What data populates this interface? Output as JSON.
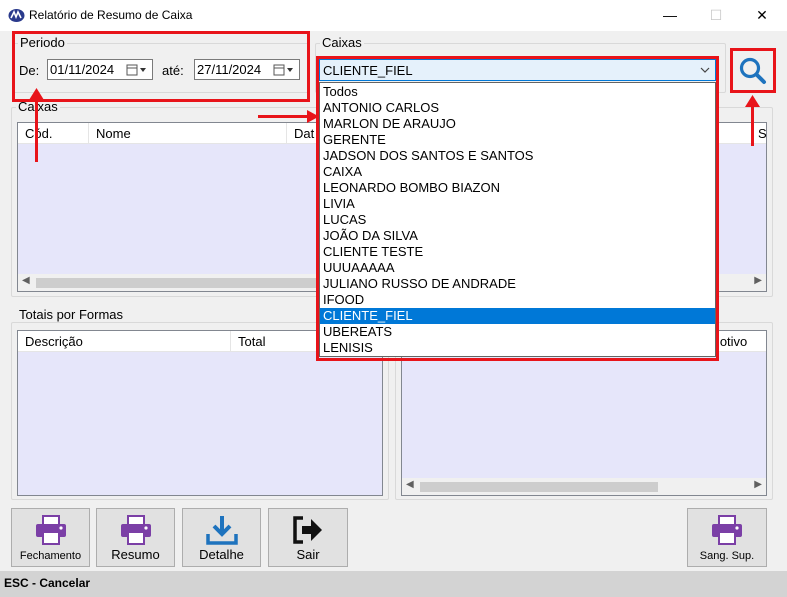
{
  "window": {
    "title": "Relatório de Resumo de Caixa",
    "minimize": "—",
    "maximize": "☐",
    "close": "✕"
  },
  "periodo": {
    "group_title": "Periodo",
    "de_label": "De:",
    "de_value": "01/11/2024",
    "ate_label": "até:",
    "ate_value": "27/11/2024"
  },
  "caixas_filter": {
    "group_title": "Caixas",
    "selected": "CLIENTE_FIEL",
    "options": [
      "Todos",
      "ANTONIO CARLOS",
      "MARLON DE ARAUJO",
      "GERENTE",
      "JADSON DOS SANTOS E SANTOS",
      "CAIXA",
      "LEONARDO BOMBO BIAZON",
      "LIVIA",
      "LUCAS",
      "JOÃO DA SILVA",
      "CLIENTE TESTE",
      "UUUAAAAA",
      "JULIANO RUSSO DE ANDRADE",
      "IFOOD",
      "CLIENTE_FIEL",
      "UBEREATS",
      "LENISIS"
    ],
    "highlighted_index": 14
  },
  "caixas_table": {
    "group_title": "Caixas",
    "columns": [
      "Cód.",
      "Nome",
      "Dat"
    ],
    "right_col_partial": "Sa"
  },
  "totais": {
    "group_title": "Totais por Formas",
    "columns": [
      "Descrição",
      "Total"
    ]
  },
  "right_table": {
    "columns_partial": "Motivo"
  },
  "buttons": {
    "fechamento": "Fechamento",
    "resumo": "Resumo",
    "detalhe": "Detalhe",
    "sair": "Sair",
    "sang_sup": "Sang. Sup."
  },
  "status": {
    "text": "ESC - Cancelar"
  },
  "colors": {
    "accent": "#0078d7",
    "annotation": "#e8141a",
    "list_bg": "#e6e6fa",
    "printer_icon": "#7b3fa6",
    "search_icon": "#1e73be"
  }
}
